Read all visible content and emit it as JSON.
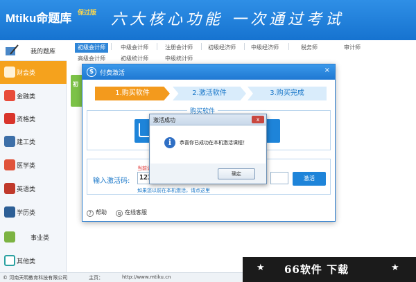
{
  "header": {
    "logo": "Mtiku命题库",
    "logo_tag": "保过版",
    "slogan": "六大核心功能 一次通过考试"
  },
  "sidebar": {
    "items": [
      {
        "label": "我的题库",
        "icon": "book-pen-icon"
      },
      {
        "label": "财会类",
        "icon": "finance-icon"
      },
      {
        "label": "金融类",
        "icon": "money-icon"
      },
      {
        "label": "资格类",
        "icon": "certificate-icon"
      },
      {
        "label": "建工类",
        "icon": "building-icon"
      },
      {
        "label": "医学类",
        "icon": "medical-kit-icon"
      },
      {
        "label": "英语类",
        "icon": "language-icon"
      },
      {
        "label": "学历类",
        "icon": "graduation-cap-icon"
      },
      {
        "label": "事业类",
        "icon": "documents-icon"
      },
      {
        "label": "其他类",
        "icon": "grid-icon"
      }
    ]
  },
  "tabs": {
    "row1": [
      "初级会计师",
      "中级会计师",
      "注册会计师",
      "初级经济师",
      "中级经济师",
      "税务师",
      "审计师"
    ],
    "row2": [
      "高级会计师",
      "初级统计师",
      "中级统计师"
    ]
  },
  "ghost_panel_text": "初",
  "payment": {
    "title": "付费激活",
    "close": "×",
    "steps": [
      "1.购买软件",
      "2.激活软件",
      "3.购买完成"
    ],
    "buy_legend": "购买软件",
    "activation_label": "输入激活码:",
    "activation_value": "123",
    "activation_warning": "当前课",
    "activate_button": "激活",
    "hint": "如果您以前在本机激活，请点这里",
    "footer_help": "帮助",
    "footer_service": "在线客服"
  },
  "dialog": {
    "title": "激活成功",
    "message": "恭喜你已成功在本机激活课程！",
    "ok": "确定",
    "close": "x"
  },
  "status": {
    "copyright": "© 河南天明教育科技有限公司",
    "home_label": "主页：",
    "home_url": "http://www.mtiku.cn"
  },
  "watermark": {
    "text": "66软件 下载"
  },
  "colors": {
    "header_blue": "#1673d0",
    "active_orange": "#f5a21d",
    "step_active": "#f39a1d",
    "link_blue": "#1b78c9"
  }
}
